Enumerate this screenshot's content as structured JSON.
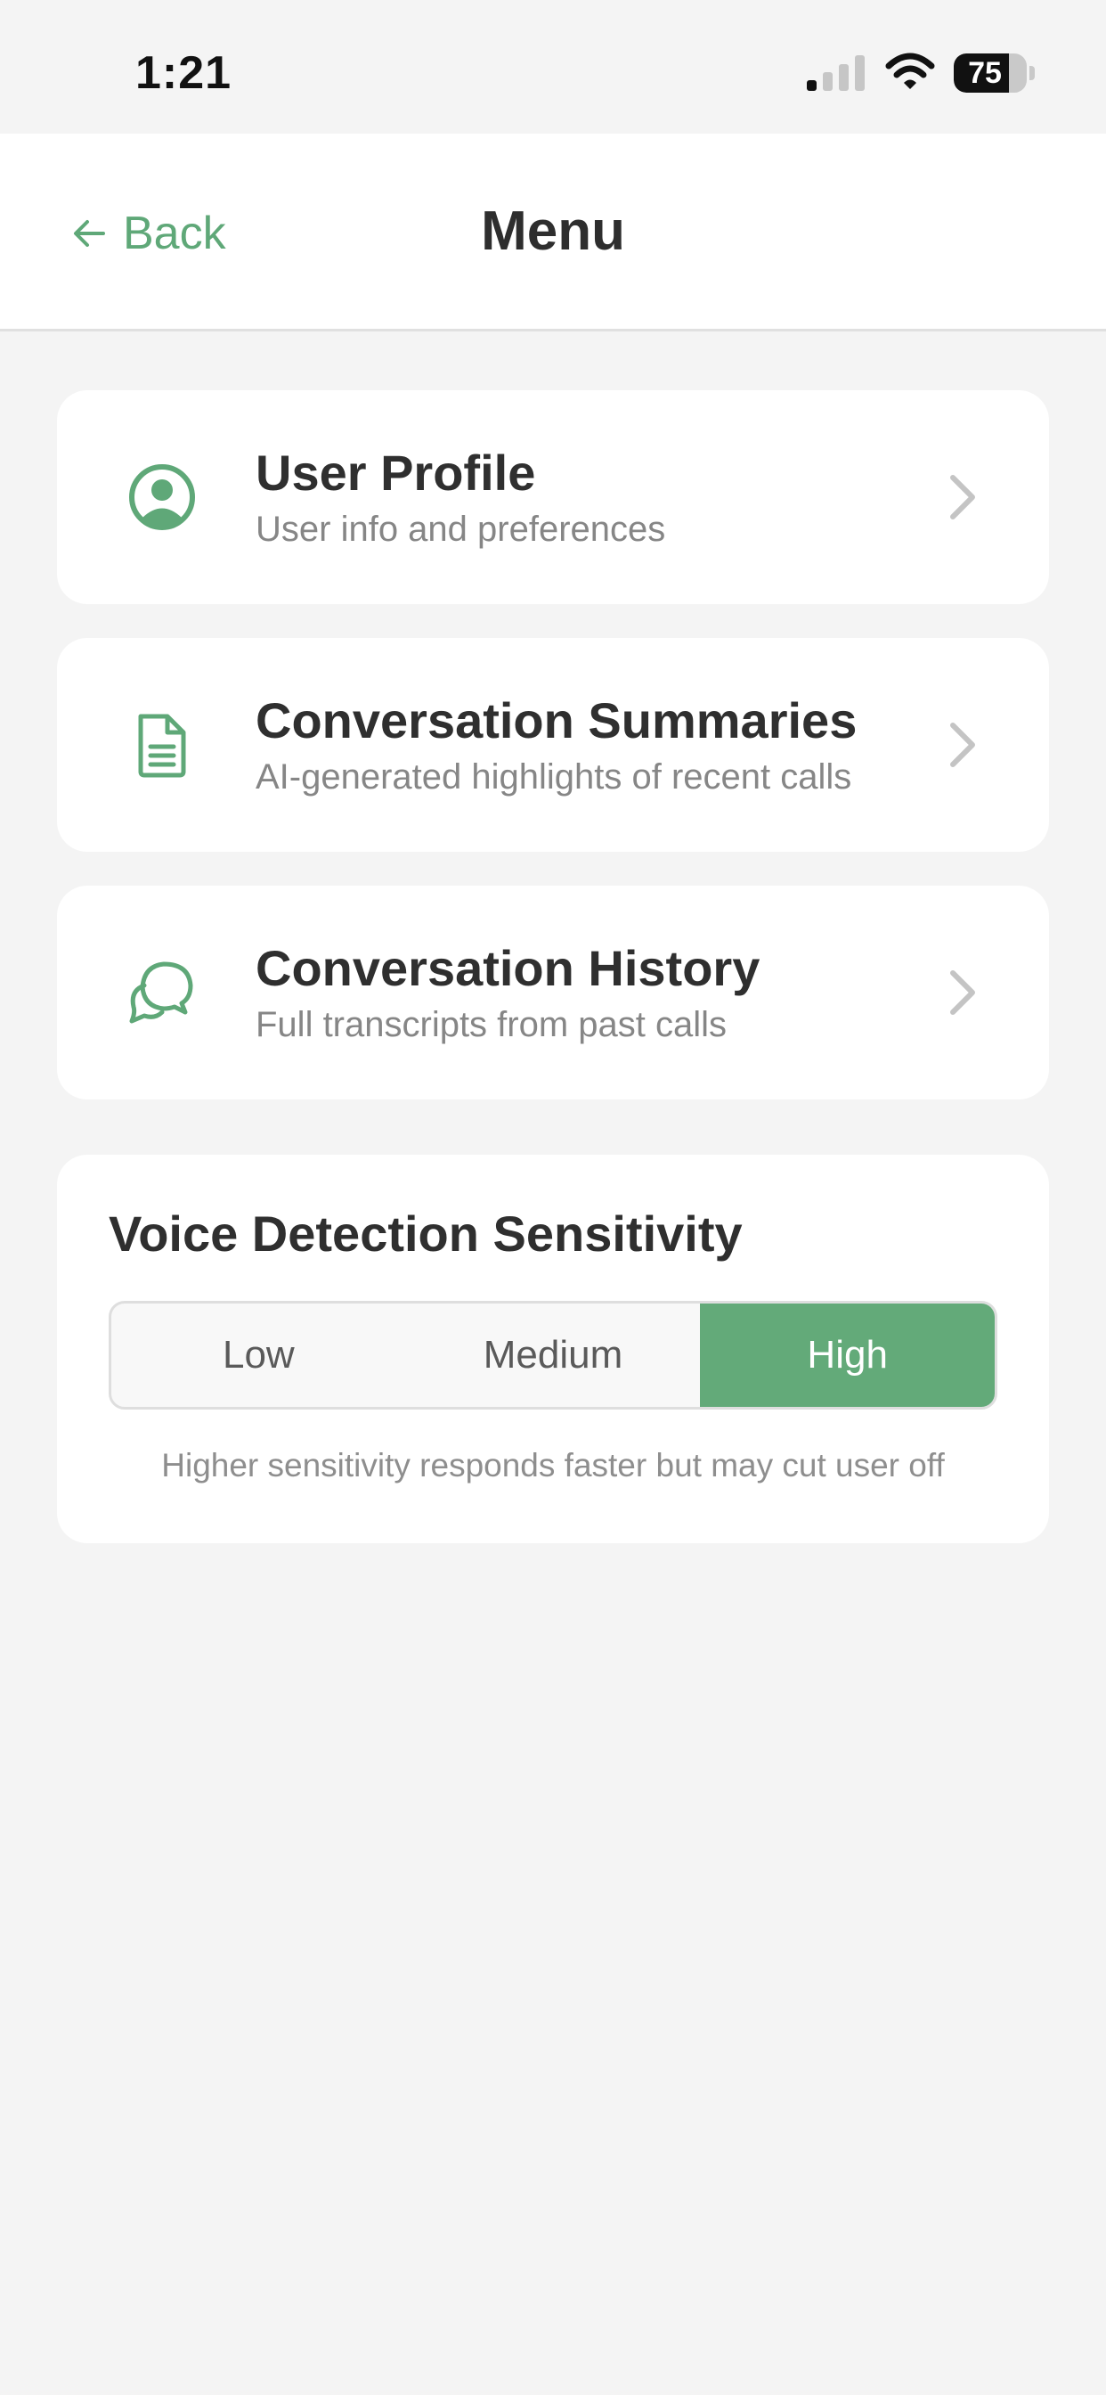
{
  "status_bar": {
    "time": "1:21",
    "battery_percent": 75,
    "battery_label": "75",
    "signal_icon": "cellular-signal-icon",
    "wifi_icon": "wifi-icon"
  },
  "header": {
    "back_label": "Back",
    "title": "Menu"
  },
  "menu_items": [
    {
      "title": "User Profile",
      "subtitle": "User info and preferences",
      "icon": "user-circle-icon"
    },
    {
      "title": "Conversation Summaries",
      "subtitle": "AI-generated highlights of recent calls",
      "icon": "document-icon"
    },
    {
      "title": "Conversation History",
      "subtitle": "Full transcripts from past calls",
      "icon": "chat-bubbles-icon"
    }
  ],
  "voice_detection": {
    "title": "Voice Detection Sensitivity",
    "options": [
      "Low",
      "Medium",
      "High"
    ],
    "selected": "High",
    "hint": "Higher sensitivity responds faster but may cut user off"
  },
  "colors": {
    "accent": "#63aa79",
    "background": "#f4f4f4",
    "card": "#ffffff",
    "title_text": "#2f2f2f",
    "subtitle_text": "#868686"
  }
}
